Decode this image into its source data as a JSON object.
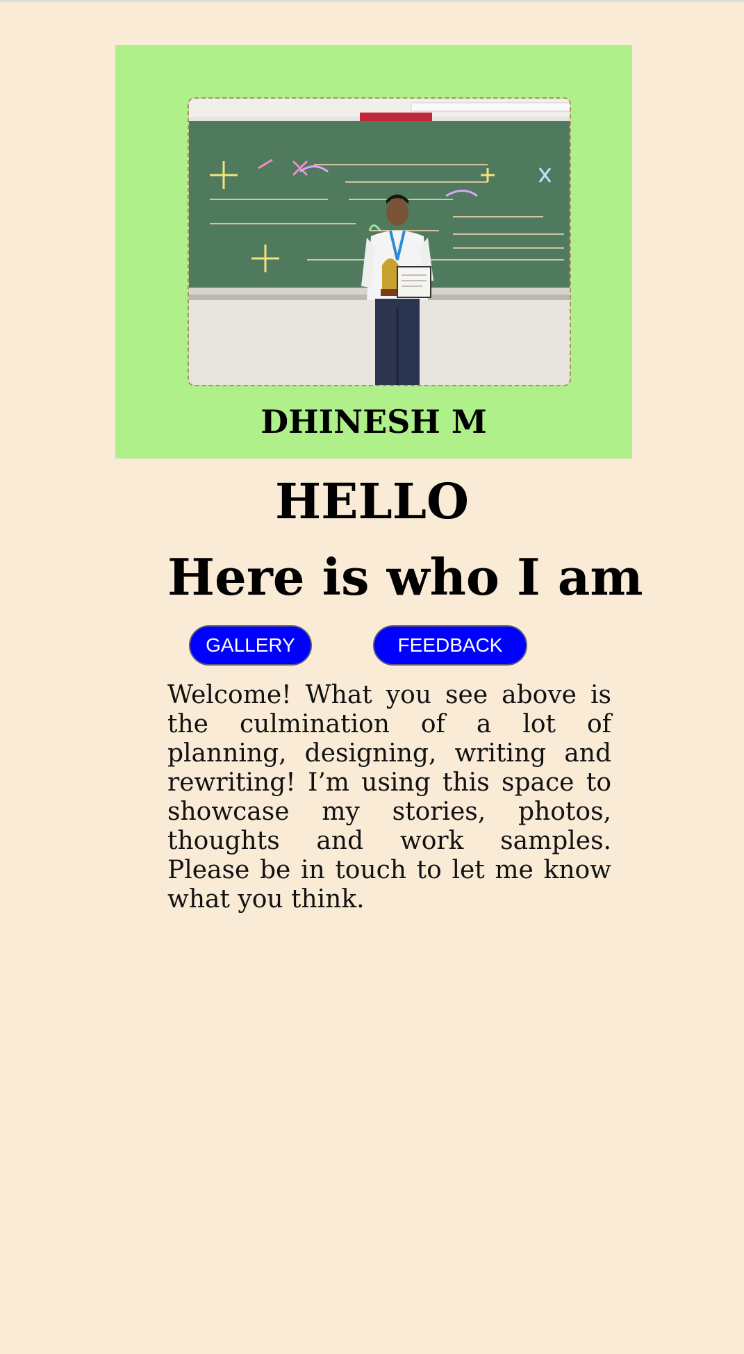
{
  "profile": {
    "photo_icon": "portrait-photo",
    "name": "DHINESH M"
  },
  "hero": {
    "greeting": "HELLO",
    "tagline": "Here is who I am"
  },
  "nav": {
    "gallery_label": "GALLERY",
    "feedback_label": "FEEDBACK"
  },
  "intro": {
    "text": "Welcome! What you see above is the culmination of a lot of planning, designing, writing and rewriting! I’m using this space to showcase my stories, photos, thoughts and work samples. Please be in touch to let me know what you think."
  },
  "colors": {
    "background": "#faebd7",
    "card": "#b0f08a",
    "button": "#0000ff",
    "button_text": "#ffffff"
  }
}
